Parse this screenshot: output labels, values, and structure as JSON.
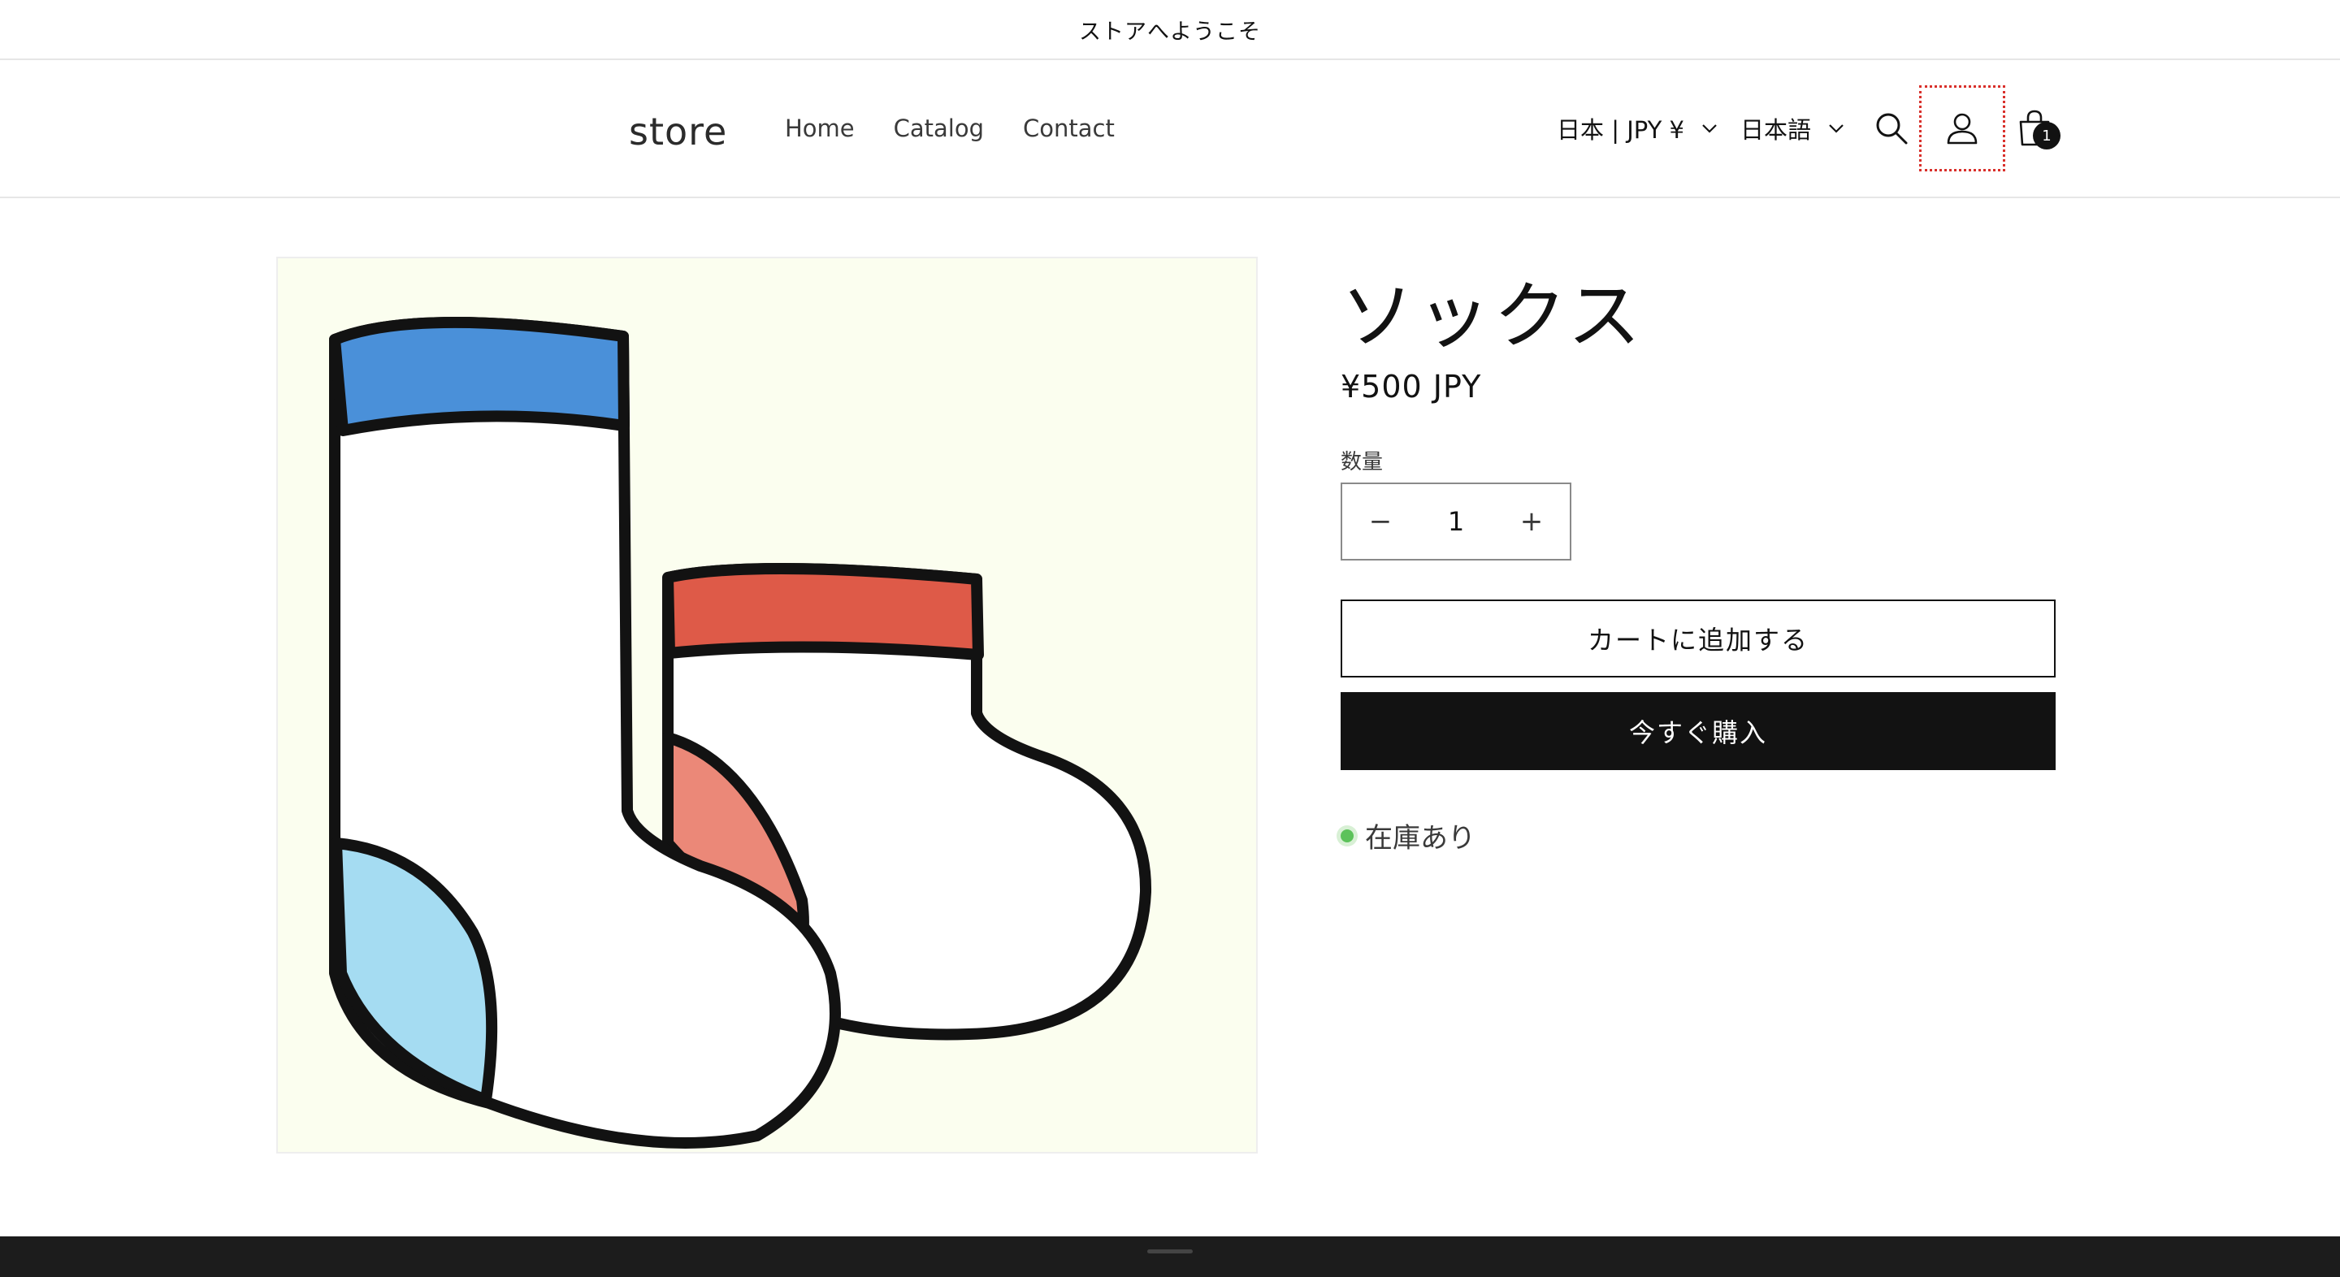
{
  "announcement": "ストアへようこそ",
  "header": {
    "logo": "store",
    "nav": [
      "Home",
      "Catalog",
      "Contact"
    ],
    "country_selector": "日本 | JPY ¥",
    "language_selector": "日本語",
    "cart_count": "1"
  },
  "product": {
    "title": "ソックス",
    "price": "¥500 JPY",
    "quantity_label": "数量",
    "quantity_value": "1",
    "decrement_symbol": "−",
    "increment_symbol": "+",
    "add_to_cart": "カートに追加する",
    "buy_now": "今すぐ購入",
    "stock_status": "在庫あり"
  },
  "colors": {
    "sock_blue_band": "#4a90d9",
    "sock_red_band": "#de5a48",
    "sock_blue_heel": "#a5dcf2",
    "sock_red_heel": "#eb8878",
    "image_background": "#fbfeef",
    "in_stock": "#5cc25a",
    "focus_outline": "#d9302b"
  },
  "icons": [
    "search-icon",
    "account-icon",
    "cart-icon",
    "chevron-down-icon"
  ]
}
